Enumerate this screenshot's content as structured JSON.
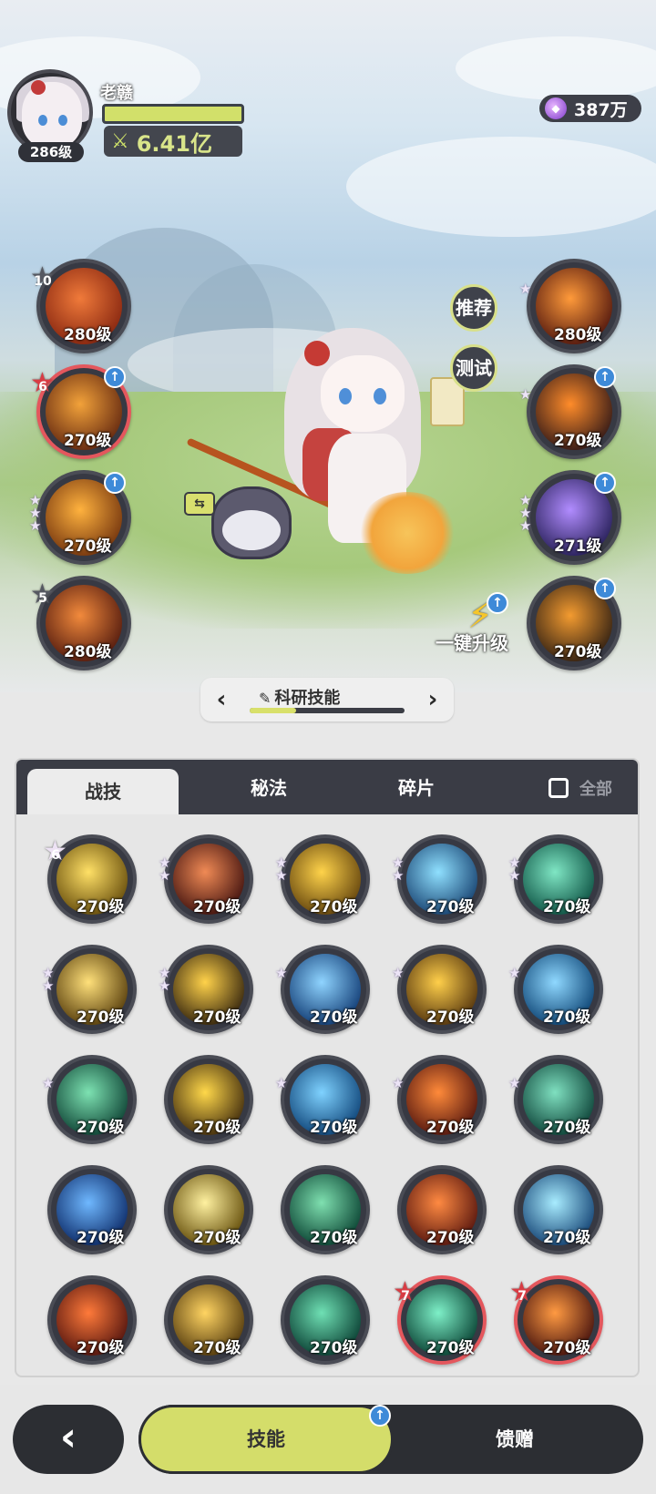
{
  "player": {
    "name": "老赣",
    "level": "286级",
    "power_icon": "swords-icon",
    "power": "6.41亿"
  },
  "currency": {
    "icon": "purple-gem-icon",
    "amount": "387万"
  },
  "left_skills": [
    {
      "level": "280级",
      "badge": "10",
      "badge_color": "gray",
      "upgrade": false,
      "colors": [
        "#f07a3a",
        "#8c2a12"
      ]
    },
    {
      "level": "270级",
      "badge": "6",
      "badge_color": "red",
      "upgrade": true,
      "colors": [
        "#f2a23a",
        "#6b2e12"
      ]
    },
    {
      "level": "270级",
      "badge": "",
      "stars": 3,
      "upgrade": true,
      "colors": [
        "#ffb23e",
        "#7a3a10"
      ]
    },
    {
      "level": "280级",
      "badge": "5",
      "badge_color": "gray",
      "upgrade": false,
      "colors": [
        "#f28a3c",
        "#5a1f10"
      ]
    }
  ],
  "right_skills": [
    {
      "level": "280级",
      "stars": 1,
      "upgrade": false,
      "colors": [
        "#ff9a3a",
        "#5a1d10"
      ]
    },
    {
      "level": "270级",
      "stars": 1,
      "upgrade": true,
      "colors": [
        "#ff8c2a",
        "#3c1e18"
      ]
    },
    {
      "level": "271级",
      "stars": 3,
      "upgrade": true,
      "colors": [
        "#b18cff",
        "#2d2460"
      ]
    },
    {
      "level": "270级",
      "stars": 0,
      "upgrade": true,
      "colors": [
        "#f39b30",
        "#3b2614"
      ]
    }
  ],
  "side_buttons": {
    "recommend": "推荐",
    "test": "测试"
  },
  "one_click_upgrade": "一键升级",
  "pager": {
    "title": "科研技能",
    "progress": 0.3
  },
  "tabs": [
    "战技",
    "秘法",
    "碎片"
  ],
  "active_tab": 0,
  "select_all_label": "全部",
  "grid_skills": [
    {
      "level": "270级",
      "badge": "6",
      "stars": 0,
      "colors": [
        "#ffe066",
        "#6e5410"
      ]
    },
    {
      "level": "270级",
      "badge": "",
      "stars": 2,
      "colors": [
        "#f08a55",
        "#4a1812"
      ]
    },
    {
      "level": "270级",
      "badge": "",
      "stars": 2,
      "colors": [
        "#ffd34a",
        "#6a4a10"
      ]
    },
    {
      "level": "270级",
      "badge": "",
      "stars": 2,
      "colors": [
        "#8fe0ff",
        "#1d4a78"
      ]
    },
    {
      "level": "270级",
      "badge": "",
      "stars": 2,
      "colors": [
        "#7fe6c4",
        "#135a4a"
      ]
    },
    {
      "level": "270级",
      "badge": "",
      "stars": 2,
      "colors": [
        "#ffe07a",
        "#5e4410"
      ]
    },
    {
      "level": "270级",
      "badge": "",
      "stars": 2,
      "colors": [
        "#ffd24a",
        "#3d2c10"
      ]
    },
    {
      "level": "270级",
      "badge": "",
      "stars": 1,
      "colors": [
        "#8fd4ff",
        "#16427a"
      ]
    },
    {
      "level": "270级",
      "badge": "",
      "stars": 1,
      "colors": [
        "#ffcf4a",
        "#5a3a10"
      ]
    },
    {
      "level": "270级",
      "badge": "",
      "stars": 1,
      "colors": [
        "#8fd8ff",
        "#124a7a"
      ]
    },
    {
      "level": "270级",
      "badge": "",
      "stars": 1,
      "colors": [
        "#7de2b2",
        "#134a3a"
      ]
    },
    {
      "level": "270级",
      "badge": "",
      "stars": 0,
      "colors": [
        "#ffd84a",
        "#4a3410"
      ]
    },
    {
      "level": "270级",
      "badge": "",
      "stars": 1,
      "colors": [
        "#7fd2ff",
        "#134a7e"
      ]
    },
    {
      "level": "270级",
      "badge": "",
      "stars": 1,
      "colors": [
        "#ff8a3a",
        "#5a1a10"
      ]
    },
    {
      "level": "270级",
      "badge": "",
      "stars": 1,
      "colors": [
        "#7fe0c0",
        "#124a3e"
      ]
    },
    {
      "level": "270级",
      "badge": "",
      "stars": 0,
      "colors": [
        "#6fb8ff",
        "#10306e"
      ]
    },
    {
      "level": "270级",
      "badge": "",
      "stars": 0,
      "colors": [
        "#fff1a0",
        "#6a5410"
      ]
    },
    {
      "level": "270级",
      "badge": "",
      "stars": 0,
      "colors": [
        "#7fe0b0",
        "#0f4a38"
      ]
    },
    {
      "level": "270级",
      "badge": "",
      "stars": 0,
      "colors": [
        "#ff8a42",
        "#5e1a10"
      ]
    },
    {
      "level": "270级",
      "badge": "",
      "stars": 0,
      "colors": [
        "#a8ecff",
        "#1a4a7a"
      ]
    },
    {
      "level": "270级",
      "badge": "",
      "stars": 0,
      "colors": [
        "#ff7a3a",
        "#5a1810"
      ]
    },
    {
      "level": "270级",
      "badge": "",
      "stars": 0,
      "colors": [
        "#ffd462",
        "#5a4010"
      ]
    },
    {
      "level": "270级",
      "badge": "",
      "stars": 0,
      "colors": [
        "#6fe0b4",
        "#0e4638"
      ]
    },
    {
      "level": "270级",
      "badge": "7",
      "badge_color": "red",
      "red_ring": true,
      "stars": 0,
      "colors": [
        "#7ef0c8",
        "#0e4a3a"
      ]
    },
    {
      "level": "270级",
      "badge": "7",
      "badge_color": "red",
      "red_ring": true,
      "stars": 0,
      "colors": [
        "#ff9a42",
        "#4e1810"
      ]
    }
  ],
  "bottom_nav": {
    "back_icon": "back-chevron-icon",
    "skill": "技能",
    "gift": "馈赠"
  }
}
